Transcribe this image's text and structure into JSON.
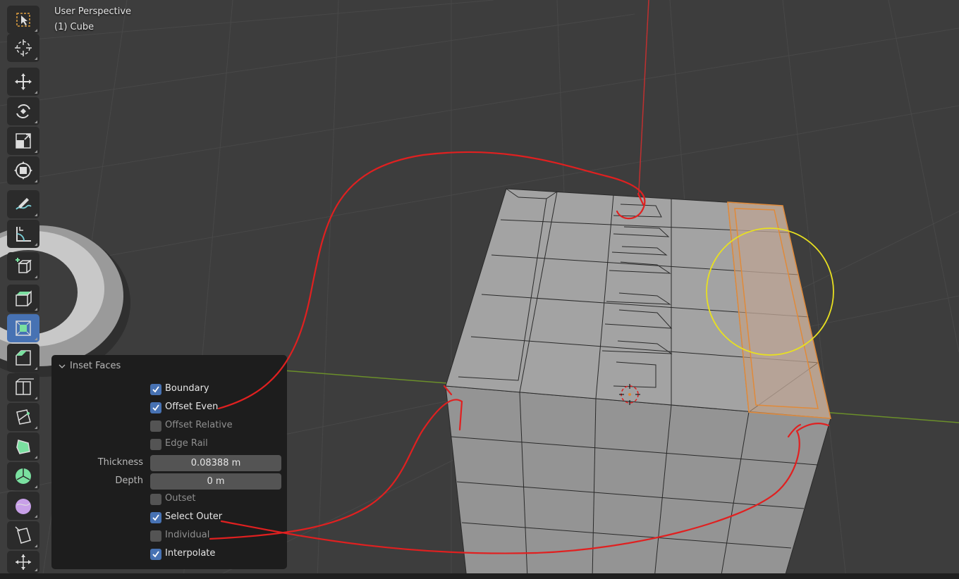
{
  "viewport": {
    "view_name": "User Perspective",
    "object_name": "(1) Cube"
  },
  "toolbar": {
    "tools": [
      {
        "icon": "select-box-icon",
        "active": false
      },
      {
        "icon": "cursor-icon",
        "active": false
      },
      {
        "icon": "move-icon",
        "active": false
      },
      {
        "icon": "rotate-icon",
        "active": false
      },
      {
        "icon": "scale-icon",
        "active": false
      },
      {
        "icon": "transform-icon",
        "active": false
      },
      {
        "icon": "annotate-icon",
        "active": false
      },
      {
        "icon": "measure-icon",
        "active": false
      },
      {
        "icon": "add-cube-icon",
        "active": false
      },
      {
        "icon": "extrude-region-icon",
        "active": false
      },
      {
        "icon": "inset-faces-icon",
        "active": true
      },
      {
        "icon": "bevel-icon",
        "active": false
      },
      {
        "icon": "loop-cut-icon",
        "active": false
      },
      {
        "icon": "knife-icon",
        "active": false
      },
      {
        "icon": "poly-build-icon",
        "active": false
      },
      {
        "icon": "spin-icon",
        "active": false
      },
      {
        "icon": "smooth-icon",
        "active": false
      },
      {
        "icon": "edge-slide-icon",
        "active": false
      },
      {
        "icon": "shrink-fatten-icon",
        "active": false
      }
    ]
  },
  "operator_panel": {
    "title": "Inset Faces",
    "boundary": {
      "label": "Boundary",
      "checked": true
    },
    "offset_even": {
      "label": "Offset Even",
      "checked": true
    },
    "offset_relative": {
      "label": "Offset Relative",
      "checked": false
    },
    "edge_rail": {
      "label": "Edge Rail",
      "checked": false
    },
    "thickness": {
      "label": "Thickness",
      "value": "0.08388 m"
    },
    "depth": {
      "label": "Depth",
      "value": "0 m"
    },
    "outset": {
      "label": "Outset",
      "checked": false
    },
    "select_outer": {
      "label": "Select Outer",
      "checked": true
    },
    "individual": {
      "label": "Individual",
      "checked": false
    },
    "interpolate": {
      "label": "Interpolate",
      "checked": true
    }
  },
  "colors": {
    "background": "#3d3d3d",
    "grid": "#4a4a4a",
    "mesh_face": "#a3a3a3",
    "selection": "#e08a3a",
    "annotation_red": "#e02020",
    "annotation_yellow": "#e8e020",
    "accent": "#4772b3"
  }
}
